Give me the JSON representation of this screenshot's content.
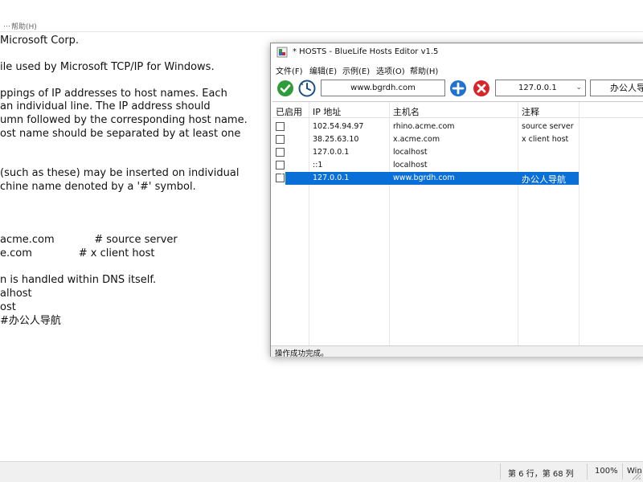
{
  "notepad": {
    "menu_help": "帮助(H)",
    "lines": [
      "Microsoft Corp.",
      "ile used by Microsoft TCP/IP for Windows.",
      "ppings of IP addresses to host names. Each",
      "an individual line. The IP address should",
      "umn followed by the corresponding host name.",
      "ost name should be separated by at least one",
      "(such as these) may be inserted on individual",
      "chine name denoted by a '#' symbol.",
      "acme.com            # source server",
      "e.com              # x client host",
      "n is handled within DNS itself.",
      "alhost",
      "ost",
      "#办公人导航"
    ],
    "status": {
      "position": "第 6 行，第 68 列",
      "zoom": "100%",
      "encoding": "Win"
    }
  },
  "hosts_editor": {
    "title": "* HOSTS - BlueLife Hosts Editor v1.5",
    "menu": [
      "文件(F)",
      "编辑(E)",
      "示例(E)",
      "选项(O)",
      "帮助(H)"
    ],
    "toolbar": {
      "host_value": "www.bgrdh.com",
      "ip_value": "127.0.0.1",
      "comment_value": "办公人导"
    },
    "columns": [
      "已启用",
      "IP 地址",
      "主机名",
      "注释"
    ],
    "rows": [
      {
        "enabled": false,
        "ip": "102.54.94.97",
        "host": "rhino.acme.com",
        "comment": "source server"
      },
      {
        "enabled": false,
        "ip": "38.25.63.10",
        "host": "x.acme.com",
        "comment": "x client host"
      },
      {
        "enabled": false,
        "ip": "127.0.0.1",
        "host": "localhost",
        "comment": ""
      },
      {
        "enabled": false,
        "ip": "::1",
        "host": "localhost",
        "comment": ""
      },
      {
        "enabled": true,
        "ip": "127.0.0.1",
        "host": "www.bgrdh.com",
        "comment": "办公人导航"
      }
    ],
    "selected_row": 4,
    "status": "操作成功完成。"
  },
  "colors": {
    "selection": "#0a6fd6",
    "accept_green": "#2e9c3a",
    "add_blue": "#1f72cf",
    "delete_red": "#d6262b"
  }
}
